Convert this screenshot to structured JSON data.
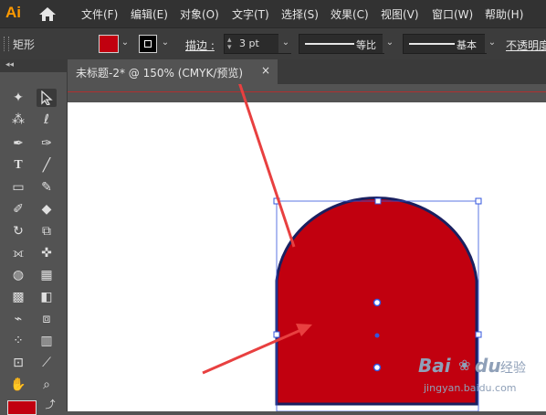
{
  "app": {
    "logo": "Ai"
  },
  "menu": [
    "文件(F)",
    "编辑(E)",
    "对象(O)",
    "文字(T)",
    "选择(S)",
    "效果(C)",
    "视图(V)",
    "窗口(W)",
    "帮助(H)"
  ],
  "control_bar": {
    "selection_label": "矩形",
    "stroke_label": "描边 :",
    "stroke_value": "3 pt",
    "profile_label": "等比",
    "brush_label": "基本",
    "opacity_label": "不透明度",
    "fill_color": "#c1000f",
    "stroke_color": "#000000"
  },
  "document": {
    "tab_title": "未标题-2* @ 150% (CMYK/预览)",
    "close_glyph": "×"
  },
  "toolbar": {
    "collapse_glyph": "◂◂"
  },
  "shape": {
    "fill": "#c1000f",
    "outline": "#1a2060",
    "selection_color": "#3355dd"
  },
  "annotation": {
    "arrow_color": "#e84040"
  },
  "watermark": {
    "brand": "Bai",
    "brand2": "du",
    "label": "经验",
    "url": "jingyan.baidu.com"
  }
}
